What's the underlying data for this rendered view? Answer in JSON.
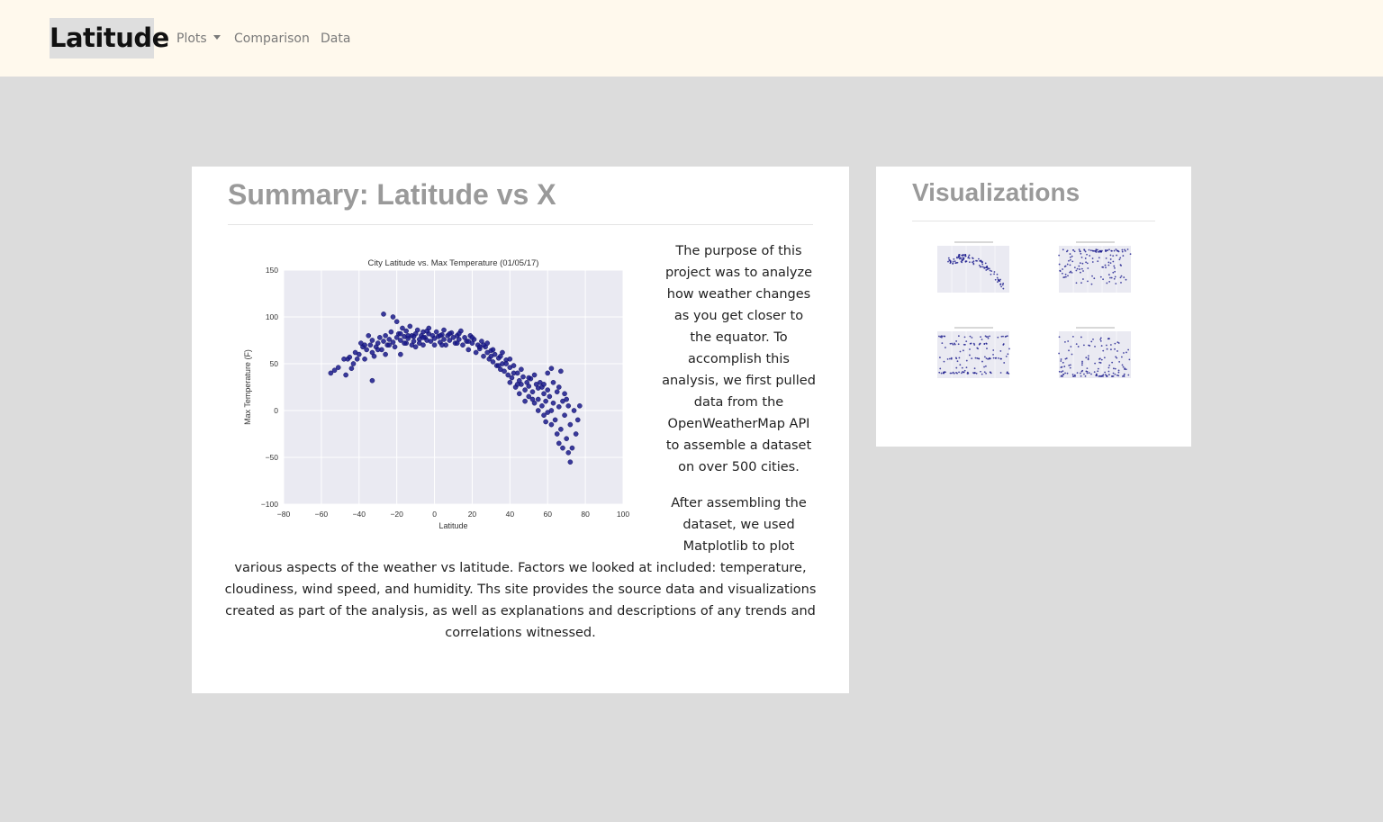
{
  "navbar": {
    "brand": "Latitude",
    "links": [
      {
        "label": "Plots"
      },
      {
        "label": "Comparison"
      },
      {
        "label": "Data"
      }
    ]
  },
  "summary": {
    "title": "Summary: Latitude vs X",
    "paragraph1_lines": [
      "The purpose of this",
      "project was to analyze",
      "how weather changes",
      "as you get closer to",
      "the equator. To",
      "accomplish this",
      "analysis, we first pulled",
      "data from the",
      "OpenWeatherMap API",
      "to assemble a dataset",
      "on over 500 cities."
    ],
    "paragraph2_lines_side": [
      "After assembling the",
      "dataset, we used",
      "Matplotlib to plot"
    ],
    "paragraph2_lines_full": [
      "various aspects of the weather vs latitude. Factors we looked at included: temperature,",
      "cloudiness, wind speed, and humidity. Ths site provides the source data and visualizations",
      "created as part of the analysis, as well as explanations and descriptions of any trends and",
      "correlations witnessed."
    ]
  },
  "visualizations": {
    "title": "Visualizations",
    "thumbnails": [
      {
        "name": "temperature-thumbnail"
      },
      {
        "name": "humidity-thumbnail"
      },
      {
        "name": "cloudiness-thumbnail"
      },
      {
        "name": "wind-speed-thumbnail"
      }
    ]
  },
  "colors": {
    "navbar_bg": "#fff9ed",
    "page_bg": "#dcdcdc",
    "plot_bg": "#eaeaf2",
    "marker": "#1a1a8c"
  },
  "chart_data": {
    "type": "scatter",
    "title": "City Latitude vs. Max Temperature (01/05/17)",
    "xlabel": "Latitude",
    "ylabel": "Max Temperature (F)",
    "xlim": [
      -80,
      100
    ],
    "ylim": [
      -100,
      150
    ],
    "xticks": [
      -80,
      -60,
      -40,
      -20,
      0,
      20,
      40,
      60,
      80,
      100
    ],
    "yticks": [
      -100,
      -50,
      0,
      50,
      100,
      150
    ],
    "xtick_labels": [
      "−80",
      "−60",
      "−40",
      "−20",
      "0",
      "20",
      "40",
      "60",
      "80",
      "100"
    ],
    "ytick_labels": [
      "−100",
      "−50",
      "0",
      "50",
      "100",
      "150"
    ],
    "grid": true,
    "points": [
      [
        -55,
        40
      ],
      [
        -53,
        43
      ],
      [
        -51,
        46
      ],
      [
        -47,
        38
      ],
      [
        -46,
        55
      ],
      [
        -45,
        57
      ],
      [
        -44,
        45
      ],
      [
        -43,
        50
      ],
      [
        -42,
        62
      ],
      [
        -40,
        60
      ],
      [
        -39,
        72
      ],
      [
        -38,
        68
      ],
      [
        -37,
        55
      ],
      [
        -36,
        65
      ],
      [
        -35,
        80
      ],
      [
        -34,
        70
      ],
      [
        -33,
        75
      ],
      [
        -33,
        62
      ],
      [
        -32,
        58
      ],
      [
        -31,
        68
      ],
      [
        -30,
        72
      ],
      [
        -29,
        78
      ],
      [
        -28,
        65
      ],
      [
        -27,
        74
      ],
      [
        -26,
        80
      ],
      [
        -25,
        70
      ],
      [
        -24,
        76
      ],
      [
        -23,
        84
      ],
      [
        -22,
        73
      ],
      [
        -21,
        68
      ],
      [
        -20,
        78
      ],
      [
        -20,
        95
      ],
      [
        -19,
        82
      ],
      [
        -18,
        75
      ],
      [
        -18,
        60
      ],
      [
        -17,
        88
      ],
      [
        -16,
        79
      ],
      [
        -15,
        72
      ],
      [
        -15,
        85
      ],
      [
        -14,
        77
      ],
      [
        -13,
        90
      ],
      [
        -12,
        80
      ],
      [
        -12,
        70
      ],
      [
        -11,
        74
      ],
      [
        -10,
        82
      ],
      [
        -10,
        68
      ],
      [
        -9,
        86
      ],
      [
        -8,
        76
      ],
      [
        -8,
        72
      ],
      [
        -7,
        80
      ],
      [
        -6,
        84
      ],
      [
        -6,
        70
      ],
      [
        -5,
        78
      ],
      [
        -4,
        75
      ],
      [
        -3,
        82
      ],
      [
        -3,
        88
      ],
      [
        -2,
        74
      ],
      [
        -1,
        80
      ],
      [
        0,
        77
      ],
      [
        0,
        70
      ],
      [
        1,
        84
      ],
      [
        2,
        79
      ],
      [
        3,
        73
      ],
      [
        4,
        81
      ],
      [
        5,
        76
      ],
      [
        5,
        86
      ],
      [
        6,
        70
      ],
      [
        7,
        80
      ],
      [
        8,
        75
      ],
      [
        9,
        83
      ],
      [
        10,
        78
      ],
      [
        11,
        72
      ],
      [
        12,
        80
      ],
      [
        13,
        76
      ],
      [
        14,
        85
      ],
      [
        15,
        70
      ],
      [
        16,
        78
      ],
      [
        17,
        74
      ],
      [
        18,
        65
      ],
      [
        19,
        80
      ],
      [
        20,
        72
      ],
      [
        21,
        76
      ],
      [
        22,
        62
      ],
      [
        23,
        70
      ],
      [
        24,
        66
      ],
      [
        25,
        74
      ],
      [
        26,
        58
      ],
      [
        27,
        68
      ],
      [
        28,
        62
      ],
      [
        29,
        55
      ],
      [
        30,
        64
      ],
      [
        31,
        52
      ],
      [
        32,
        60
      ],
      [
        33,
        48
      ],
      [
        34,
        56
      ],
      [
        35,
        44
      ],
      [
        36,
        50
      ],
      [
        37,
        42
      ],
      [
        38,
        54
      ],
      [
        39,
        38
      ],
      [
        40,
        46
      ],
      [
        40,
        30
      ],
      [
        41,
        35
      ],
      [
        42,
        48
      ],
      [
        43,
        25
      ],
      [
        44,
        40
      ],
      [
        45,
        32
      ],
      [
        45,
        18
      ],
      [
        46,
        28
      ],
      [
        47,
        36
      ],
      [
        48,
        22
      ],
      [
        49,
        30
      ],
      [
        50,
        15
      ],
      [
        50,
        26
      ],
      [
        51,
        34
      ],
      [
        52,
        20
      ],
      [
        53,
        8
      ],
      [
        54,
        28
      ],
      [
        55,
        12
      ],
      [
        55,
        24
      ],
      [
        56,
        30
      ],
      [
        57,
        5
      ],
      [
        58,
        18
      ],
      [
        58,
        -5
      ],
      [
        59,
        10
      ],
      [
        60,
        22
      ],
      [
        60,
        -2
      ],
      [
        61,
        15
      ],
      [
        62,
        0
      ],
      [
        62,
        -15
      ],
      [
        63,
        8
      ],
      [
        64,
        -10
      ],
      [
        65,
        20
      ],
      [
        65,
        -25
      ],
      [
        66,
        4
      ],
      [
        66,
        -35
      ],
      [
        67,
        -20
      ],
      [
        68,
        10
      ],
      [
        68,
        -40
      ],
      [
        69,
        -5
      ],
      [
        70,
        -30
      ],
      [
        70,
        12
      ],
      [
        71,
        -45
      ],
      [
        72,
        -15
      ],
      [
        72,
        -55
      ],
      [
        73,
        -40
      ],
      [
        74,
        0
      ],
      [
        75,
        -25
      ],
      [
        76,
        -10
      ],
      [
        77,
        5
      ],
      [
        -41,
        55
      ],
      [
        -37,
        70
      ],
      [
        -30,
        65
      ],
      [
        -24,
        70
      ],
      [
        -18,
        82
      ],
      [
        -11,
        79
      ],
      [
        -4,
        85
      ],
      [
        3,
        80
      ],
      [
        8,
        82
      ],
      [
        13,
        82
      ],
      [
        20,
        78
      ],
      [
        26,
        70
      ],
      [
        31,
        65
      ],
      [
        35,
        58
      ],
      [
        38,
        50
      ],
      [
        42,
        40
      ],
      [
        46,
        44
      ],
      [
        50,
        35
      ],
      [
        53,
        38
      ],
      [
        57,
        25
      ],
      [
        60,
        40
      ],
      [
        63,
        30
      ],
      [
        66,
        25
      ],
      [
        69,
        18
      ],
      [
        48,
        10
      ],
      [
        44,
        28
      ],
      [
        40,
        55
      ],
      [
        36,
        62
      ],
      [
        34,
        48
      ],
      [
        30,
        58
      ],
      [
        -48,
        55
      ],
      [
        -26,
        60
      ],
      [
        -16,
        72
      ],
      [
        -6,
        78
      ],
      [
        4,
        70
      ],
      [
        12,
        72
      ],
      [
        18,
        74
      ],
      [
        24,
        68
      ],
      [
        28,
        72
      ],
      [
        52,
        12
      ],
      [
        58,
        28
      ],
      [
        62,
        45
      ],
      [
        67,
        42
      ],
      [
        71,
        5
      ],
      [
        -33,
        32
      ],
      [
        -22,
        100
      ],
      [
        -27,
        103
      ],
      [
        -14,
        80
      ],
      [
        55,
        0
      ],
      [
        59,
        -12
      ]
    ]
  }
}
